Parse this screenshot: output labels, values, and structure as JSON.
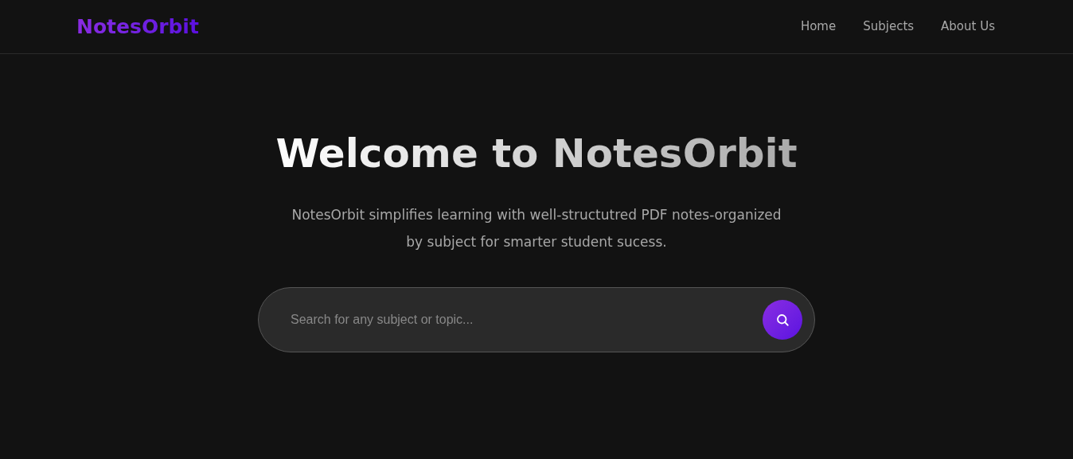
{
  "header": {
    "logo": "NotesOrbit",
    "nav": [
      {
        "label": "Home"
      },
      {
        "label": "Subjects"
      },
      {
        "label": "About Us"
      }
    ]
  },
  "hero": {
    "title": "Welcome to NotesOrbit",
    "subtitle": "NotesOrbit simplifies learning with well-structutred PDF notes-organized by subject for smarter student sucess.",
    "search": {
      "placeholder": "Search for any subject or topic..."
    }
  }
}
